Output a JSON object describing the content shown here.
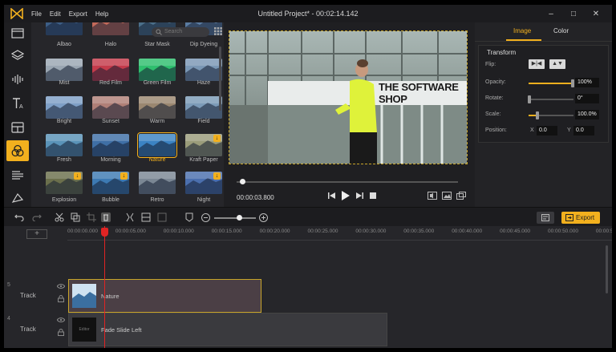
{
  "app": {
    "menu": [
      "File",
      "Edit",
      "Export",
      "Help"
    ],
    "title": "Untitled Project* - 00:02:14.142",
    "window_controls": [
      "–",
      "□",
      "✕"
    ]
  },
  "library": {
    "search_placeholder": "Search",
    "rows": [
      [
        "Albao",
        "Halo",
        "Star Mask",
        "Dip Dyeing"
      ],
      [
        "Mist",
        "Red Film",
        "Green Film",
        "Haze"
      ],
      [
        "Bright",
        "Sunset",
        "Warm",
        "Field"
      ],
      [
        "Fresh",
        "Morning",
        "Nature",
        "Kraft Paper"
      ],
      [
        "Explosion",
        "Bubble",
        "Retro",
        "Night"
      ]
    ],
    "selected": "Nature"
  },
  "preview": {
    "overlay_text": "THE SOFTWARE SHOP",
    "current_time": "00:00:03.800",
    "progress": 0.015
  },
  "properties": {
    "tabs": [
      "Image",
      "Color"
    ],
    "active_tab": "Image",
    "section": "Transform",
    "flip_label": "Flip:",
    "opacity_label": "Opacity:",
    "opacity_value": "100%",
    "opacity_level": 1.0,
    "rotate_label": "Rotate:",
    "rotate_value": "0°",
    "scale_label": "Scale:",
    "scale_value": "100.0%",
    "scale_level": 0.2,
    "position_label": "Position:",
    "pos_x_label": "X",
    "pos_x": "0.0",
    "pos_y_label": "Y",
    "pos_y": "0.0"
  },
  "toolbar": {
    "export_label": "Export",
    "zoom_level": 0.6
  },
  "timeline": {
    "add_track": "+",
    "ticks": [
      "00:00:00.000",
      "00:00:05.000",
      "00:00:10.000",
      "00:00:15.000",
      "00:00:20.000",
      "00:00:25.000",
      "00:00:30.000",
      "00:00:35.000",
      "00:00:40.000",
      "00:00:45.000",
      "00:00:50.000",
      "00:00:5"
    ],
    "tracks": [
      {
        "num": "5",
        "label": "Track",
        "clip": "Nature"
      },
      {
        "num": "4",
        "label": "Track",
        "clip": "Fade Slide Left"
      }
    ],
    "thumb_text": "Editor"
  },
  "colors": {
    "accent": "#f2b01e",
    "playhead": "#e02424",
    "background": "#232326"
  }
}
